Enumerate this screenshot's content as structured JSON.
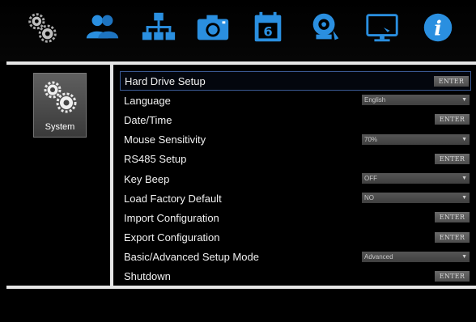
{
  "toolbar": {
    "icons": [
      "settings-gears-icon",
      "users-icon",
      "network-icon",
      "camera-icon",
      "calendar-schedule-icon",
      "alarm-bell-icon",
      "monitor-display-icon",
      "info-icon"
    ]
  },
  "sidebar": {
    "items": [
      {
        "label": "System",
        "icon": "gears-icon",
        "selected": true
      }
    ]
  },
  "settings": {
    "rows": [
      {
        "label": "Hard Drive Setup",
        "control": "button",
        "value": "ENTER",
        "selected": true
      },
      {
        "label": "Language",
        "control": "dropdown",
        "value": "English"
      },
      {
        "label": "Date/Time",
        "control": "button",
        "value": "ENTER"
      },
      {
        "label": "Mouse Sensitivity",
        "control": "dropdown",
        "value": "70%"
      },
      {
        "label": "RS485 Setup",
        "control": "button",
        "value": "ENTER"
      },
      {
        "label": "Key Beep",
        "control": "dropdown",
        "value": "OFF"
      },
      {
        "label": "Load Factory Default",
        "control": "dropdown",
        "value": "NO"
      },
      {
        "label": "Import Configuration",
        "control": "button",
        "value": "ENTER"
      },
      {
        "label": "Export Configuration",
        "control": "button",
        "value": "ENTER"
      },
      {
        "label": "Basic/Advanced Setup Mode",
        "control": "dropdown",
        "value": "Advanced"
      },
      {
        "label": "Shutdown",
        "control": "button",
        "value": "ENTER"
      }
    ]
  },
  "colors": {
    "background": "#000000",
    "icon_blue": "#2a8fe0",
    "selection_border": "#3b5a95",
    "frame": "#e6e6e6"
  }
}
